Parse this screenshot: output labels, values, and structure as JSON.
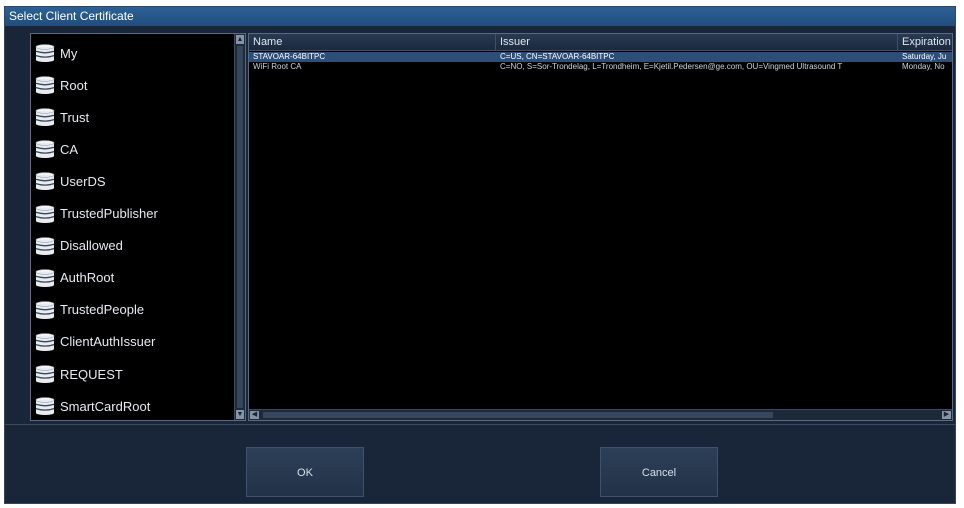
{
  "dialog": {
    "title": "Select Client Certificate"
  },
  "stores": {
    "selected_index": 0,
    "items": [
      {
        "label": "My",
        "icon": "database-icon"
      },
      {
        "label": "Root",
        "icon": "database-icon"
      },
      {
        "label": "Trust",
        "icon": "database-icon"
      },
      {
        "label": "CA",
        "icon": "database-icon"
      },
      {
        "label": "UserDS",
        "icon": "database-icon"
      },
      {
        "label": "TrustedPublisher",
        "icon": "database-icon"
      },
      {
        "label": "Disallowed",
        "icon": "database-icon"
      },
      {
        "label": "AuthRoot",
        "icon": "database-icon"
      },
      {
        "label": "TrustedPeople",
        "icon": "database-icon"
      },
      {
        "label": "ClientAuthIssuer",
        "icon": "database-icon"
      },
      {
        "label": "REQUEST",
        "icon": "database-icon"
      },
      {
        "label": "SmartCardRoot",
        "icon": "database-icon"
      }
    ]
  },
  "certificates": {
    "columns": [
      "Name",
      "Issuer",
      "Expiration"
    ],
    "selected_index": 0,
    "rows": [
      {
        "name": "STAVOAR-64BITPC",
        "issuer": "C=US, CN=STAVOAR-64BITPC",
        "expiration": "Saturday, Ju"
      },
      {
        "name": "WiFi Root CA",
        "issuer": "C=NO, S=Sor-Trondelag, L=Trondheim, E=Kjetil.Pedersen@ge.com, OU=Vingmed Ultrasound T",
        "expiration": "Monday, No"
      }
    ]
  },
  "buttons": {
    "ok_label": "OK",
    "cancel_label": "Cancel"
  },
  "colors": {
    "title_bar": "#245284",
    "dialog_bg": "#19263a",
    "selected_row": "#2c4e78",
    "list_bg": "#000000"
  }
}
